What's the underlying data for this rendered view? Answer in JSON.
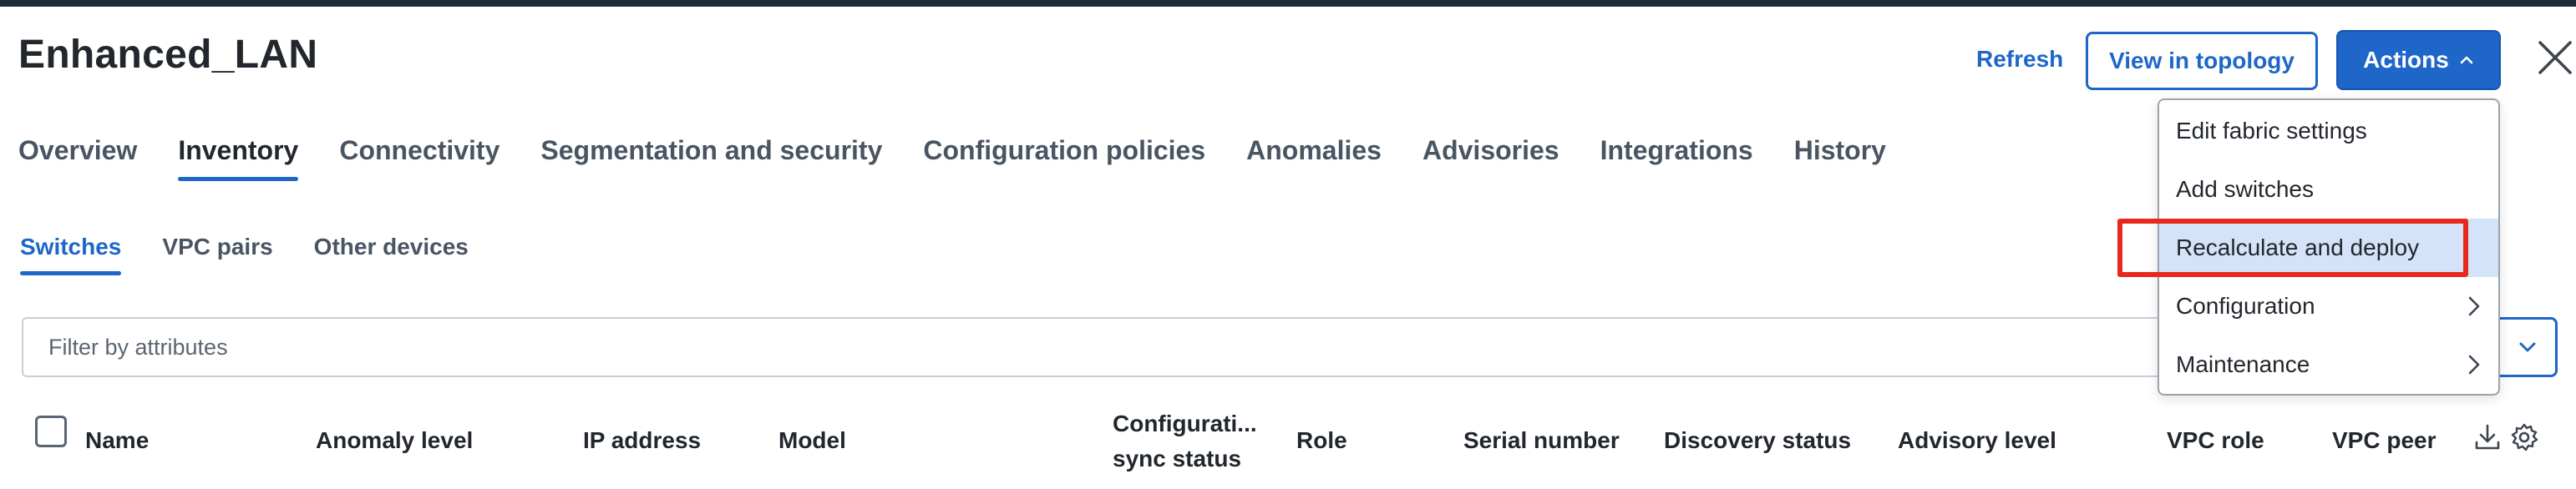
{
  "page": {
    "title": "Enhanced_LAN"
  },
  "header": {
    "refresh_label": "Refresh",
    "topology_label": "View in topology",
    "actions_label": "Actions"
  },
  "tabs": [
    {
      "label": "Overview"
    },
    {
      "label": "Inventory",
      "active": true
    },
    {
      "label": "Connectivity"
    },
    {
      "label": "Segmentation and security"
    },
    {
      "label": "Configuration policies"
    },
    {
      "label": "Anomalies"
    },
    {
      "label": "Advisories"
    },
    {
      "label": "Integrations"
    },
    {
      "label": "History"
    }
  ],
  "subtabs": [
    {
      "label": "Switches",
      "active": true
    },
    {
      "label": "VPC pairs"
    },
    {
      "label": "Other devices"
    }
  ],
  "filter": {
    "placeholder": "Filter by attributes"
  },
  "table": {
    "columns": [
      {
        "label": "Name"
      },
      {
        "label": "Anomaly level"
      },
      {
        "label": "IP address"
      },
      {
        "label": "Model"
      },
      {
        "label": "Configurati...",
        "line2": "sync status"
      },
      {
        "label": "Role"
      },
      {
        "label": "Serial number"
      },
      {
        "label": "Discovery status"
      },
      {
        "label": "Advisory level"
      },
      {
        "label": "VPC role"
      },
      {
        "label": "VPC peer"
      }
    ]
  },
  "actions_menu": {
    "items": [
      {
        "label": "Edit fabric settings"
      },
      {
        "label": "Add switches"
      },
      {
        "label": "Recalculate and deploy",
        "highlighted": true
      },
      {
        "label": "Configuration",
        "submenu": true
      },
      {
        "label": "Maintenance",
        "submenu": true
      }
    ]
  },
  "colors": {
    "accent": "#1e66c8",
    "highlight_border": "#e8281c",
    "menu_hover": "#d4e3f8",
    "top_strip": "#1d2b3d"
  }
}
